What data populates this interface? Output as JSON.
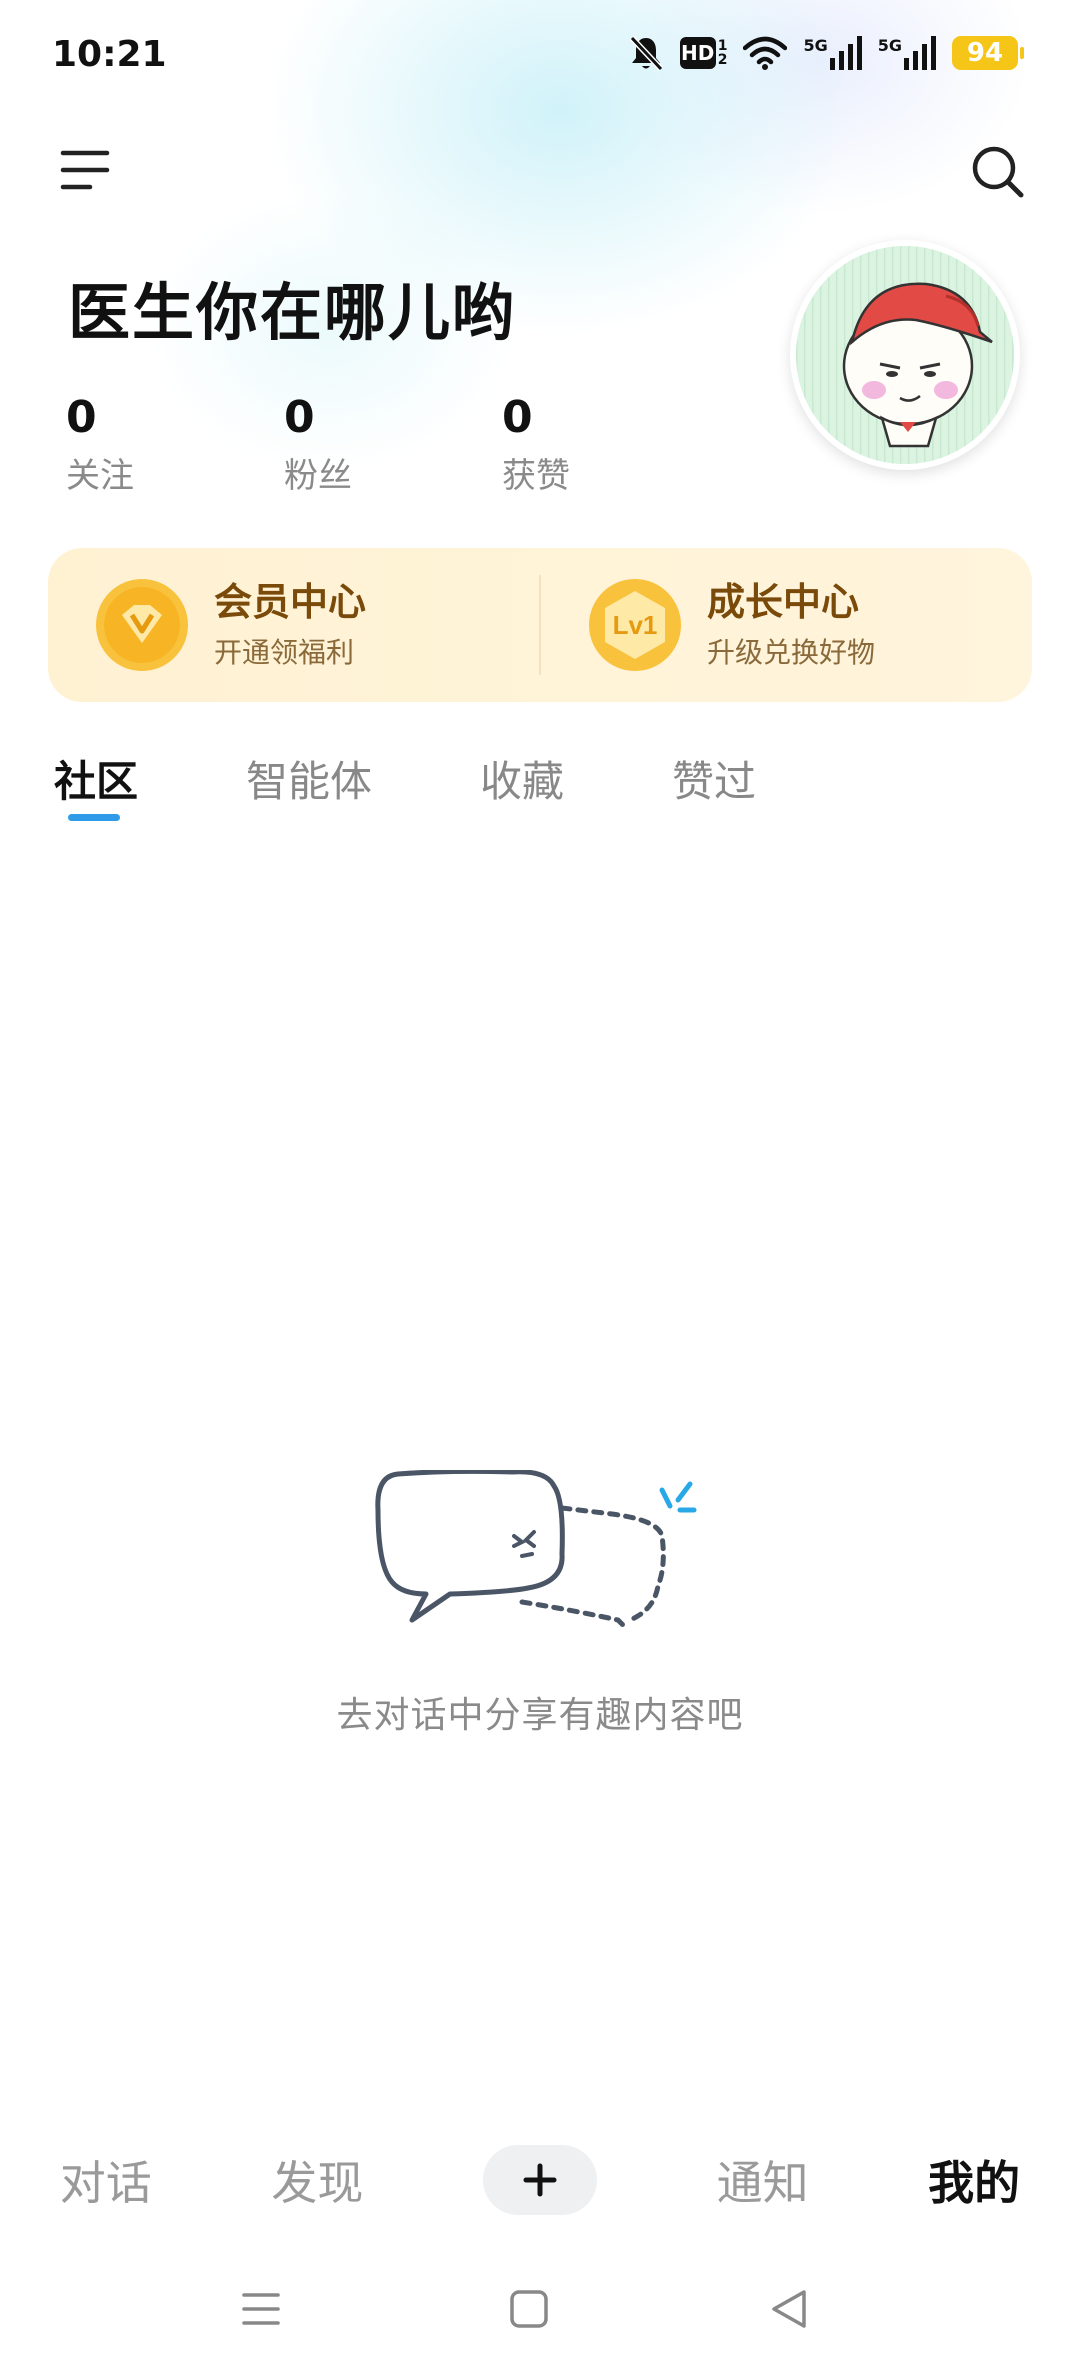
{
  "status_bar": {
    "time": "10:21",
    "hd_sub_top": "1",
    "hd_sub_bottom": "2",
    "hd_label": "HD",
    "net1_label": "5G",
    "net2_label": "5G",
    "battery": "94",
    "icons": [
      "bell-off-icon",
      "wifi-icon",
      "signal-icon",
      "battery-icon"
    ]
  },
  "header": {
    "username": "医生你在哪儿哟",
    "stats": [
      {
        "value": "0",
        "label": "关注"
      },
      {
        "value": "0",
        "label": "粉丝"
      },
      {
        "value": "0",
        "label": "获赞"
      }
    ]
  },
  "vip_card": {
    "member": {
      "title": "会员中心",
      "subtitle": "开通领福利",
      "icon_text": "V"
    },
    "growth": {
      "title": "成长中心",
      "subtitle": "升级兑换好物",
      "icon_text": "Lv1"
    }
  },
  "tabs": [
    {
      "label": "社区",
      "active": true
    },
    {
      "label": "智能体",
      "active": false
    },
    {
      "label": "收藏",
      "active": false
    },
    {
      "label": "赞过",
      "active": false
    }
  ],
  "empty_state": {
    "text": "去对话中分享有趣内容吧"
  },
  "bottom_nav": {
    "items": [
      "对话",
      "发现",
      "通知",
      "我的"
    ],
    "active": "我的",
    "plus": "+"
  },
  "colors": {
    "accent": "#2f9be8",
    "vip_bg": "#fff2d3",
    "vip_text": "#7a4a0a",
    "battery": "#f5c518"
  }
}
